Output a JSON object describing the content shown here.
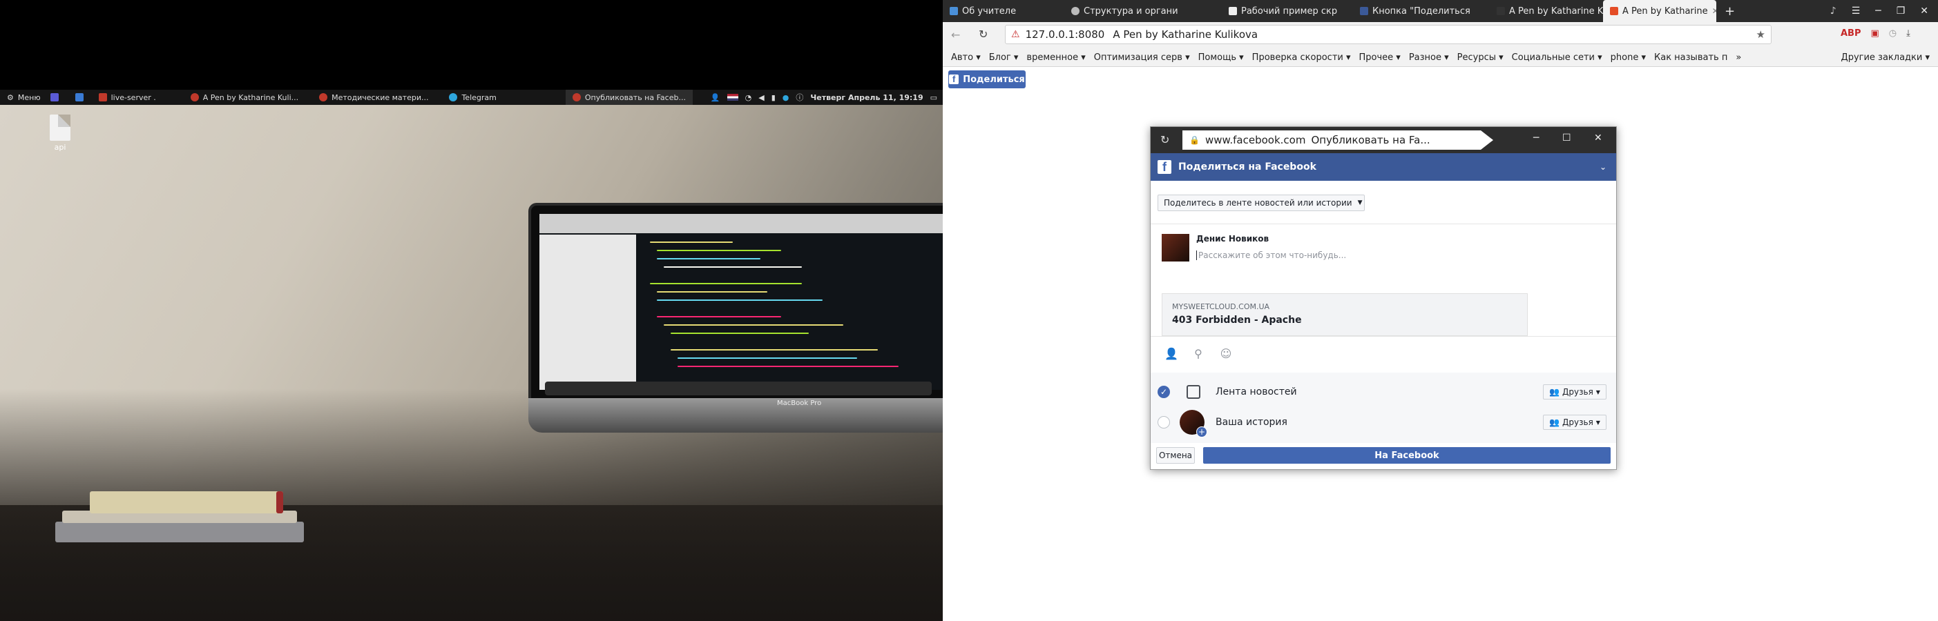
{
  "taskbar": {
    "menu_label": "Меню",
    "items": [
      {
        "label": "live-server .",
        "color": "#c0392b"
      },
      {
        "label": "A Pen by Katharine Kuli...",
        "color": "#c0392b"
      },
      {
        "label": "Методические матери...",
        "color": "#c0392b"
      },
      {
        "label": "Telegram",
        "color": "#2ea6dd"
      },
      {
        "label": "Опубликовать на Faceb...",
        "color": "#c0392b"
      }
    ],
    "clock": "Четверг Апрель 11, 19:19"
  },
  "desktop": {
    "file_label": "api",
    "laptop_brand": "MacBook Pro"
  },
  "browser": {
    "tabs": [
      {
        "label": "Об учителе",
        "icon": "page-icon",
        "color": "#4a90d9"
      },
      {
        "label": "Структура и органи",
        "icon": "gear-icon",
        "color": "#bbbbbb"
      },
      {
        "label": "Рабочий пример скр",
        "icon": "doc-icon",
        "color": "#eeeeee"
      },
      {
        "label": "Кнопка \"Поделиться",
        "icon": "facebook-icon",
        "color": "#3b5998"
      },
      {
        "label": "A Pen by Katharine K",
        "icon": "codepen-icon",
        "color": "#333333"
      },
      {
        "label": "A Pen by Katharine",
        "icon": "codepen-icon",
        "color": "#e44d26"
      }
    ],
    "new_tab_label": "+",
    "address": {
      "host": "127.0.0.1:8080",
      "title": "A Pen by Katharine Kulikova"
    },
    "bookmarks": [
      "Авто ▾",
      "Блог ▾",
      "временное ▾",
      "Оптимизация серв ▾",
      "Помощь ▾",
      "Проверка скорости ▾",
      "Прочее ▾",
      "Разное ▾",
      "Ресурсы ▾",
      "Социальные сети ▾",
      "phone ▾",
      "Как называть п"
    ],
    "bookmarks_more": "»",
    "other_bookmarks": "Другие закладки ▾"
  },
  "page": {
    "share_button_label": "Поделиться"
  },
  "popup": {
    "url_host": "www.facebook.com",
    "url_title": "Опубликовать на Fa...",
    "header_title": "Поделиться на Facebook",
    "share_target": "Поделитесь в ленте новостей или истории",
    "user_name": "Денис Новиков",
    "composer_placeholder": "Расскажите об этом что-нибудь...",
    "link_domain": "MYSWEETCLOUD.COM.UA",
    "link_title": "403 Forbidden - Apache",
    "destinations": [
      {
        "label": "Лента новостей",
        "checked": true,
        "audience": "Друзья"
      },
      {
        "label": "Ваша история",
        "checked": false,
        "audience": "Друзья"
      }
    ],
    "cancel_label": "Отмена",
    "post_label": "На Facebook"
  },
  "colors": {
    "facebook_blue": "#3b5998",
    "facebook_button": "#4267b2"
  }
}
